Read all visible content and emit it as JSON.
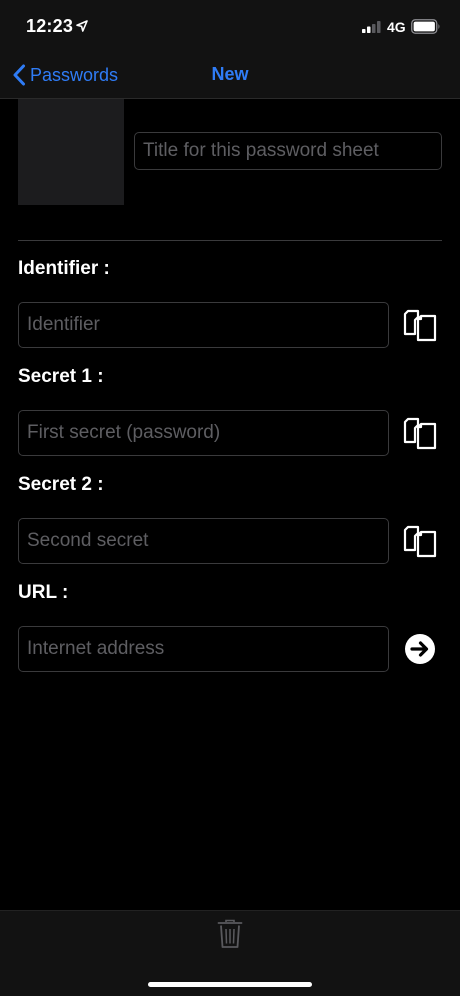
{
  "status_bar": {
    "time": "12:23",
    "network": "4G"
  },
  "nav": {
    "back_label": "Passwords",
    "title": "New"
  },
  "header": {
    "title_placeholder": "Title for this password sheet"
  },
  "fields": {
    "identifier": {
      "label": "Identifier :",
      "placeholder": "Identifier"
    },
    "secret1": {
      "label": "Secret 1 :",
      "placeholder": "First secret (password)"
    },
    "secret2": {
      "label": "Secret 2 :",
      "placeholder": "Second secret"
    },
    "url": {
      "label": "URL :",
      "placeholder": "Internet address"
    }
  },
  "colors": {
    "accent": "#2f7cf6",
    "background": "#000000",
    "bar_background": "#121212",
    "field_border": "#3a3a3c",
    "placeholder": "#5e5e62"
  },
  "icons": {
    "location": "location-arrow-icon",
    "signal": "cellular-signal-icon",
    "battery": "battery-icon",
    "back": "chevron-left-icon",
    "copy": "copy-icon",
    "open_url": "arrow-right-circle-icon",
    "delete": "trash-icon"
  }
}
